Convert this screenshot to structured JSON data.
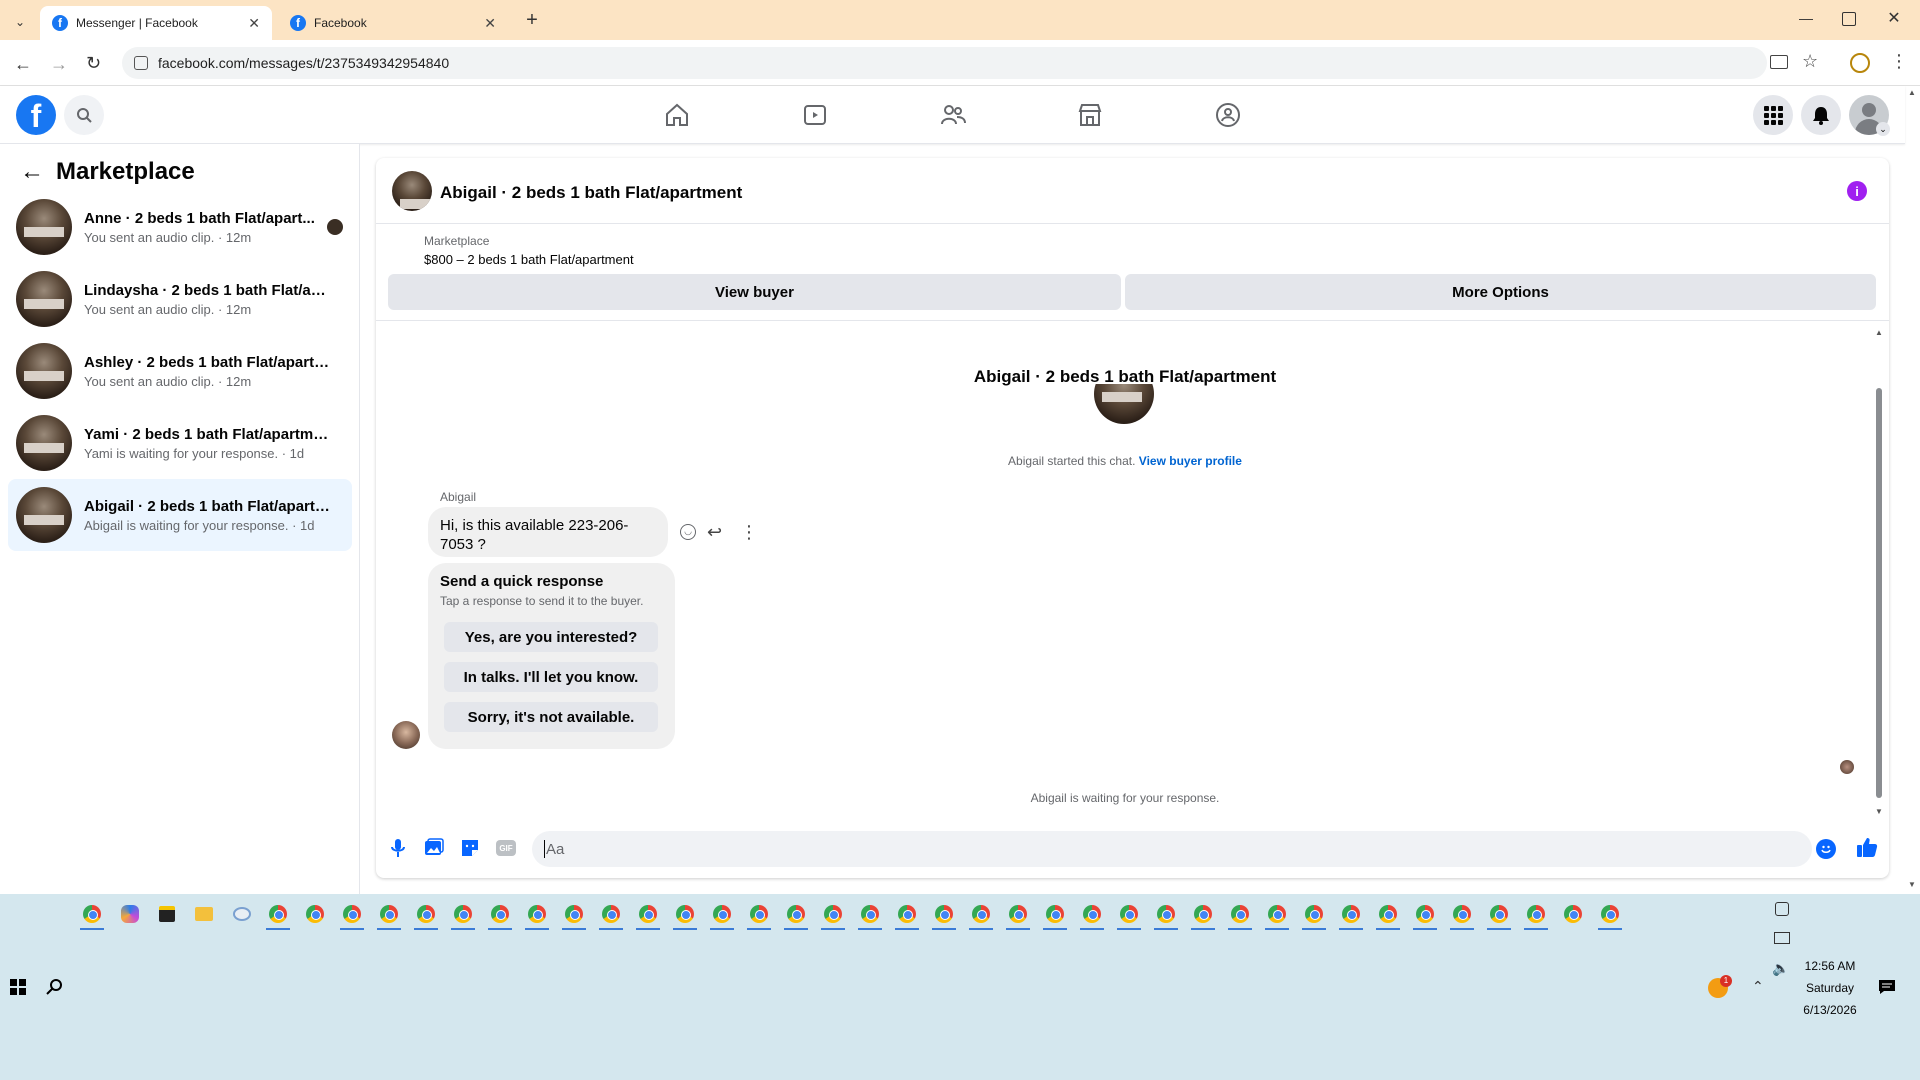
{
  "browser": {
    "tabs": [
      {
        "label": "Messenger | Facebook"
      },
      {
        "label": "Facebook"
      }
    ],
    "url": "facebook.com/messages/t/2375349342954840"
  },
  "sidebar": {
    "title": "Marketplace",
    "conversations": [
      {
        "name": "Anne · 2 beds 1 bath Flat/apart...",
        "preview": "You sent an audio clip. · 12m"
      },
      {
        "name": "Lindaysha · 2 beds 1 bath Flat/apar...",
        "preview": "You sent an audio clip. · 12m"
      },
      {
        "name": "Ashley · 2 beds 1 bath Flat/apartm...",
        "preview": "You sent an audio clip. · 12m"
      },
      {
        "name": "Yami · 2 beds 1 bath Flat/apartment",
        "preview": "Yami is waiting for your response. · 1d"
      },
      {
        "name": "Abigail · 2 beds 1 bath Flat/apartm...",
        "preview": "Abigail is waiting for your response. · 1d"
      }
    ]
  },
  "chat": {
    "header_title": "Abigail · 2 beds 1 bath Flat/apartment",
    "listing_label": "Marketplace",
    "listing_title": "$800 – 2 beds 1 bath Flat/apartment",
    "view_buyer_label": "View buyer",
    "more_options_label": "More Options",
    "profile_name": "Abigail · 2 beds 1 bath Flat/apartment",
    "started_text": "Abigail started this chat.",
    "view_profile_link": "View buyer profile",
    "sender_name": "Abigail",
    "message_text": "Hi, is this available 223-206-7053 ?",
    "quick_title": "Send a quick response",
    "quick_subtitle": "Tap a response to send it to the buyer.",
    "quick_replies": [
      "Yes, are you interested?",
      "In talks. I'll let you know.",
      "Sorry, it's not available."
    ],
    "waiting_text": "Abigail is waiting for your response.",
    "input_placeholder": "Aa"
  },
  "taskbar": {
    "time": "12:56 AM",
    "day": "Saturday",
    "date": "6/13/2026",
    "notification_count": "1"
  },
  "colors": {
    "fb_blue": "#1877f2",
    "link_blue": "#0064d1",
    "info_purple": "#a020f0",
    "tabbar": "#fce4c4",
    "taskbar": "#d4e7ee"
  }
}
